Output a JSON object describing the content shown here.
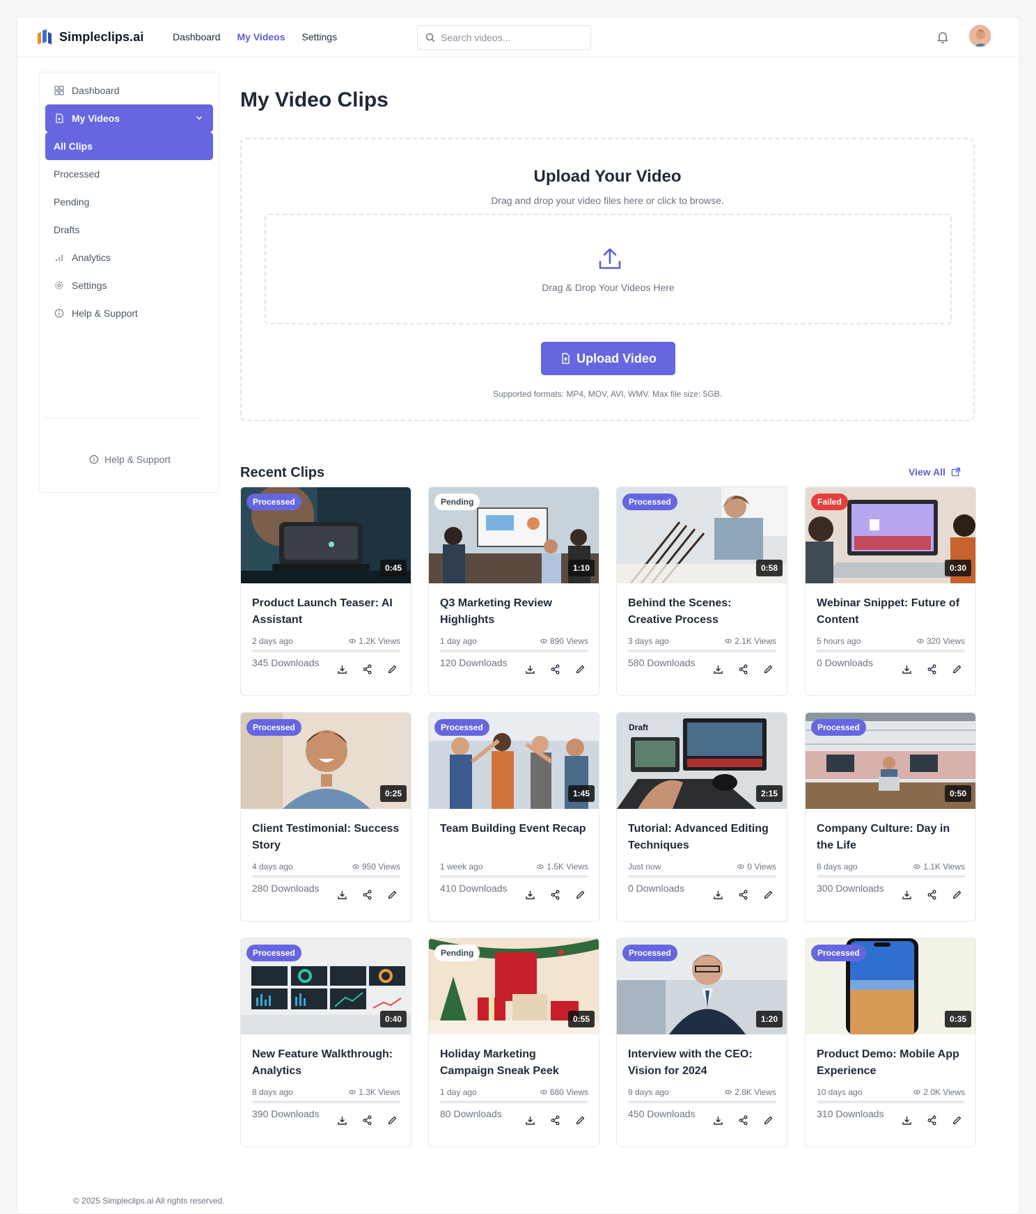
{
  "brand": {
    "name": "Simpleclips.ai"
  },
  "topnav": [
    {
      "label": "Dashboard",
      "active": false
    },
    {
      "label": "My Videos",
      "active": true
    },
    {
      "label": "Settings",
      "active": false
    }
  ],
  "search": {
    "placeholder": "Search videos..."
  },
  "sidebar": {
    "dashboard": "Dashboard",
    "my_videos": "My Videos",
    "all_clips": "All Clips",
    "processed": "Processed",
    "pending": "Pending",
    "drafts": "Drafts",
    "analytics": "Analytics",
    "settings": "Settings",
    "help": "Help & Support",
    "footer_help": "Help & Support"
  },
  "page": {
    "title": "My Video Clips"
  },
  "upload": {
    "title": "Upload Your Video",
    "subtitle": "Drag and drop your video files here or click to browse.",
    "drop_text": "Drag & Drop Your Videos Here",
    "button": "Upload Video",
    "note": "Supported formats: MP4, MOV, AVI, WMV. Max file size: 5GB."
  },
  "recent": {
    "title": "Recent Clips",
    "view_all": "View All"
  },
  "clips": [
    {
      "status": "Processed",
      "status_kind": "processed",
      "duration": "0:45",
      "title": "Product Launch Teaser: AI Assistant",
      "age": "2 days ago",
      "views": "1.2K Views",
      "downloads": "345 Downloads",
      "thumb": "device"
    },
    {
      "status": "Pending",
      "status_kind": "pending",
      "duration": "1:10",
      "title": "Q3 Marketing Review Highlights",
      "age": "1 day ago",
      "views": "890 Views",
      "downloads": "120 Downloads",
      "thumb": "meeting"
    },
    {
      "status": "Processed",
      "status_kind": "processed",
      "duration": "0:58",
      "title": "Behind the Scenes: Creative Process",
      "age": "3 days ago",
      "views": "2.1K Views",
      "downloads": "580 Downloads",
      "thumb": "artist"
    },
    {
      "status": "Failed",
      "status_kind": "failed",
      "duration": "0:30",
      "title": "Webinar Snippet: Future of Content",
      "age": "5 hours ago",
      "views": "320 Views",
      "downloads": "0 Downloads",
      "thumb": "webinar"
    },
    {
      "status": "Processed",
      "status_kind": "processed",
      "duration": "0:25",
      "title": "Client Testimonial: Success Story",
      "age": "4 days ago",
      "views": "950 Views",
      "downloads": "280 Downloads",
      "thumb": "portrait"
    },
    {
      "status": "Processed",
      "status_kind": "processed",
      "duration": "1:45",
      "title": "Team Building Event Recap",
      "age": "1 week ago",
      "views": "1.5K Views",
      "downloads": "410 Downloads",
      "thumb": "team"
    },
    {
      "status": "Draft",
      "status_kind": "draft",
      "duration": "2:15",
      "title": "Tutorial: Advanced Editing Techniques",
      "age": "Just now",
      "views": "0 Views",
      "downloads": "0 Downloads",
      "thumb": "editing"
    },
    {
      "status": "Processed",
      "status_kind": "processed",
      "duration": "0:50",
      "title": "Company Culture: Day in the Life",
      "age": "6 days ago",
      "views": "1.1K Views",
      "downloads": "300 Downloads",
      "thumb": "office"
    },
    {
      "status": "Processed",
      "status_kind": "processed",
      "duration": "0:40",
      "title": "New Feature Walkthrough: Analytics",
      "age": "8 days ago",
      "views": "1.3K Views",
      "downloads": "390 Downloads",
      "thumb": "analytics"
    },
    {
      "status": "Pending",
      "status_kind": "pending",
      "duration": "0:55",
      "title": "Holiday Marketing Campaign Sneak Peek",
      "age": "1 day ago",
      "views": "680 Views",
      "downloads": "80 Downloads",
      "thumb": "holiday"
    },
    {
      "status": "Processed",
      "status_kind": "processed",
      "duration": "1:20",
      "title": "Interview with the CEO: Vision for 2024",
      "age": "9 days ago",
      "views": "2.8K Views",
      "downloads": "450 Downloads",
      "thumb": "ceo"
    },
    {
      "status": "Processed",
      "status_kind": "processed",
      "duration": "0:35",
      "title": "Product Demo: Mobile App Experience",
      "age": "10 days ago",
      "views": "2.0K Views",
      "downloads": "310 Downloads",
      "thumb": "phone"
    }
  ],
  "footer": {
    "copyright": "© 2025 Simpleclips.ai  All rights reserved."
  },
  "colors": {
    "accent": "#6566e0",
    "failed": "#e53e3e",
    "text": "#1f2937",
    "muted": "#6b7280"
  }
}
